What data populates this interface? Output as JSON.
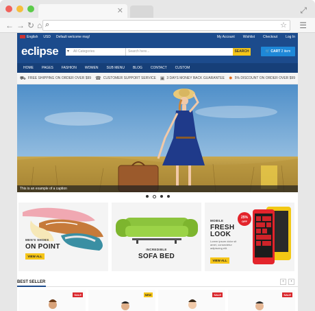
{
  "browser": {
    "dot_colors": [
      "#f0625b",
      "#f6be3c",
      "#5ccb4a"
    ],
    "tab_close": "✕",
    "fullscreen_icon": "expand-icon",
    "menu_icon": "hamburger-icon",
    "nav_icons": [
      "←",
      "→",
      "↻",
      "⌂"
    ],
    "url_star": "☆"
  },
  "topbar": {
    "language": "English",
    "currency": "USD",
    "welcome": "Default welcome msg!",
    "links": [
      "My Account",
      "Wishlist",
      "Checkout",
      "Log In"
    ]
  },
  "header": {
    "logo": "eclipse",
    "category_placeholder": "All Categories",
    "search_placeholder": "Search here...",
    "search_button": "SEARCH",
    "cart_label": "CART",
    "cart_count": "2 item"
  },
  "nav": [
    "HOME",
    "PAGES",
    "FASHION",
    "WOMEN",
    "SUB MENU",
    "BLOG",
    "CONTACT",
    "CUSTOM"
  ],
  "info": [
    {
      "icon": "truck-icon",
      "glyph": "⛟",
      "text": "FREE SHIPPING ON ORDER OVER $99"
    },
    {
      "icon": "headset-icon",
      "glyph": "☎",
      "text": "CUSTOMER SUPPORT SERVICE"
    },
    {
      "icon": "money-back-icon",
      "glyph": "▣",
      "text": "3 DAYS MONEY BACK GUARANTEE"
    },
    {
      "icon": "discount-star-icon",
      "glyph": "✸",
      "text": "5% DISCOUNT ON ORDER OVER $99"
    }
  ],
  "hero": {
    "caption": "This is an example of a caption",
    "slide_count": 4,
    "active_slide": 2,
    "colors": {
      "sky_top": "#5a9bd1",
      "sky_bottom": "#a8cbe8",
      "field": "#a88a3a",
      "dress": "#1f3a8a"
    }
  },
  "promos": [
    {
      "small": "MEN'S SHOES",
      "big": "ON POINT",
      "button": "VIEW ALL"
    },
    {
      "small": "INCREDIBLE",
      "big": "SOFA BED"
    },
    {
      "small": "MOBILE",
      "big1": "FRESH",
      "big2": "LOOK",
      "desc1": "Lorem ipsum dolor sit",
      "desc2": "amet, consectetur",
      "desc3": "adipiscing elit.",
      "badge": "25%",
      "badge_sub": "OFF",
      "button": "VIEW ALL"
    }
  ],
  "bestseller": {
    "title": "BEST SELLER",
    "prev": "‹",
    "next": "›",
    "badges": [
      {
        "label": "SALE",
        "color": "#d9262b"
      },
      {
        "label": "NEW",
        "color": "#f5c518"
      },
      {
        "label": "SALE",
        "color": "#d9262b"
      },
      {
        "label": "SALE",
        "color": "#d9262b"
      }
    ]
  }
}
